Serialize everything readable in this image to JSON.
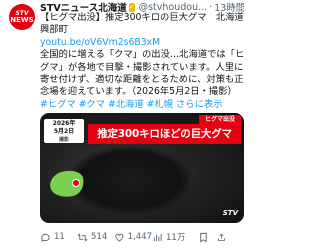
{
  "post": {
    "avatar_text_top": "STV",
    "avatar_text_bottom": "NEWS",
    "account_name": "STVニュース北海道",
    "handle": "@stvhoudou...",
    "dot": "·",
    "time": "13時間",
    "more": "···",
    "text_lines": [
      "【ヒグマ出没】推定300キロの巨大グマ　北海道",
      "興部町",
      "",
      "全国的に増える「クマ」の出没…北海道では「ヒ",
      "グマ」が各地で目撃・撮影されています。人里に",
      "寄せ付けず、適切な距離をとるために、対策も正",
      "念場を迎えています。（2026年5月2日・撮影）"
    ],
    "link": "youtu.be/oV6Vm2s6B3xM",
    "hashtags": "#ヒグマ #クマ #北海道 #札幌",
    "more_link": "さらに表示"
  },
  "media": {
    "date_line1": "2026年",
    "date_line2": "5月2日",
    "date_line3": "撮影",
    "red_tag": "ヒグマ出没",
    "banner": "推定300キロほどの巨大グマ",
    "logo": "STV"
  },
  "actions": {
    "reply_count": "11",
    "retweet_count": "514",
    "like_count": "1,447",
    "view_count": "11万",
    "reply_icon": "reply-icon",
    "retweet_icon": "retweet-icon",
    "like_icon": "heart-icon",
    "view_icon": "views-icon",
    "bookmark_icon": "bookmark-icon",
    "share_icon": "share-icon"
  },
  "colors": {
    "link": "#1d9bf0",
    "brand_red": "#e50012",
    "muted": "#536471"
  }
}
